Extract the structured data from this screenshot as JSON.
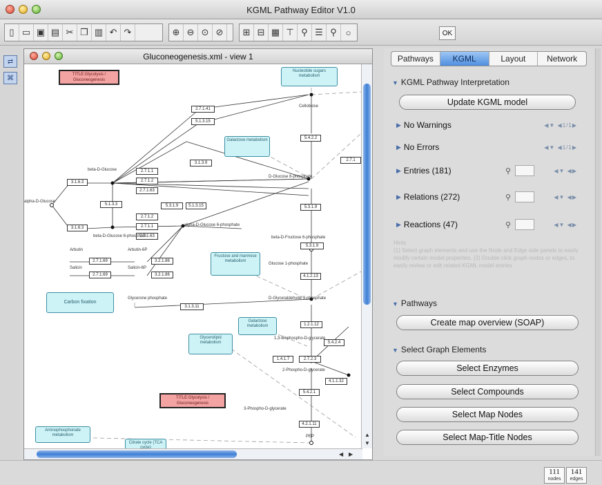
{
  "window": {
    "title": "KGML Pathway Editor V1.0"
  },
  "toolbar": {
    "icons": [
      "new-file-icon",
      "open-folder-icon",
      "save-icon",
      "print-icon",
      "cut-icon",
      "copy-icon",
      "paste-icon",
      "undo-icon",
      "redo-icon",
      "zoom-in-icon",
      "zoom-out-icon",
      "zoom-fit-icon",
      "zoom-reset-icon",
      "align-icon",
      "layout-icon",
      "grid-icon",
      "tree-icon",
      "tool-icon",
      "list-icon",
      "search-icon"
    ],
    "ok_label": "OK"
  },
  "graph_window": {
    "title": "Gluconeogenesis.xml - view 1",
    "title_nodes": [
      "TITLE:Glycolysis / Gluconeogenesis",
      "TITLE:Glycolysis / Gluconeogenesis"
    ],
    "map_nodes": [
      "Nucleotide sugars metabolism",
      "Galactose metabolism",
      "Fructose and mannose metabolism",
      "Carbon fixation",
      "Galactose metabolism",
      "Glycerolipid metabolism",
      "Aminophosphonate metabolism",
      "Citrate cycle (TCA cycle)"
    ],
    "enzymes": [
      "2.7.1.41",
      "5.1.3.15",
      "5.4.2.2",
      "3.1.3.9",
      "2.7.1.1",
      "2.7.1.2",
      "2.7.1.63",
      "3.1.6.3",
      "5.1.3.3",
      "3.1.6.3",
      "5.3.1.9",
      "2.7.1.2",
      "2.7.1.1",
      "2.7.1.63",
      "5.1.3.15",
      "5.3.1.9",
      "2.7.1.69",
      "3.2.1.86",
      "2.7.1.69",
      "3.2.1.86",
      "5.3.1.9",
      "4.1.2.13",
      "3.1.3.11",
      "1.2.1.12",
      "5.4.2.4",
      "1.4.1.7",
      "2.7.2.3",
      "4.1.1.32",
      "5.4.2.1",
      "4.2.1.11",
      "2.7.1"
    ],
    "compounds": [
      "Cellobiose",
      "beta-D-Glucose",
      "D-Glucose 6-phosphate",
      "alpha-D-Glucose",
      "alpha-D-Glucose 6-phosphate",
      "Arbutin",
      "Arbutin-6P",
      "Salicin",
      "Salicin-6P",
      "beta-D-Glucose 6-phosphate",
      "beta-D-Fructose 6-phosphate",
      "Glycerone phosphate",
      "D-Glyceraldehyde 3-phosphate",
      "3-Phospho-D-glycerate",
      "1,3-Bisphospho-D-glycerate",
      "2-Phospho-D-glycerate",
      "PEP",
      "Glucose 1-phosphate"
    ]
  },
  "tabs": [
    {
      "label": "Pathways",
      "active": false
    },
    {
      "label": "KGML",
      "active": true
    },
    {
      "label": "Layout",
      "active": false
    },
    {
      "label": "Network",
      "active": false
    }
  ],
  "panel": {
    "interpretation_header": "KGML Pathway Interpretation",
    "update_button": "Update KGML model",
    "warnings": "No Warnings",
    "errors": "No Errors",
    "entries": "Entries (181)",
    "relations": "Relations (272)",
    "reactions": "Reactions (47)",
    "hint_title": "Hints",
    "hint_text": "(1) Select graph elements and use the Node and Edge side panels to easily modify certain model properties. (2) Double click graph nodes or edges, to easily review or edit related KGML model entries",
    "pathways_header": "Pathways",
    "map_overview_button": "Create map overview (SOAP)",
    "select_header": "Select Graph Elements",
    "select_buttons": [
      "Select Enzymes",
      "Select Compounds",
      "Select Map Nodes",
      "Select Map-Title Nodes"
    ],
    "counter_text": "1/1"
  },
  "status": {
    "nodes_value": "111",
    "nodes_label": "nodes",
    "edges_value": "141",
    "edges_label": "edges"
  },
  "colors": {
    "tab_active": "#4f8ee0",
    "map_node": "#cdf3f7",
    "title_node": "#f4a3a3"
  }
}
